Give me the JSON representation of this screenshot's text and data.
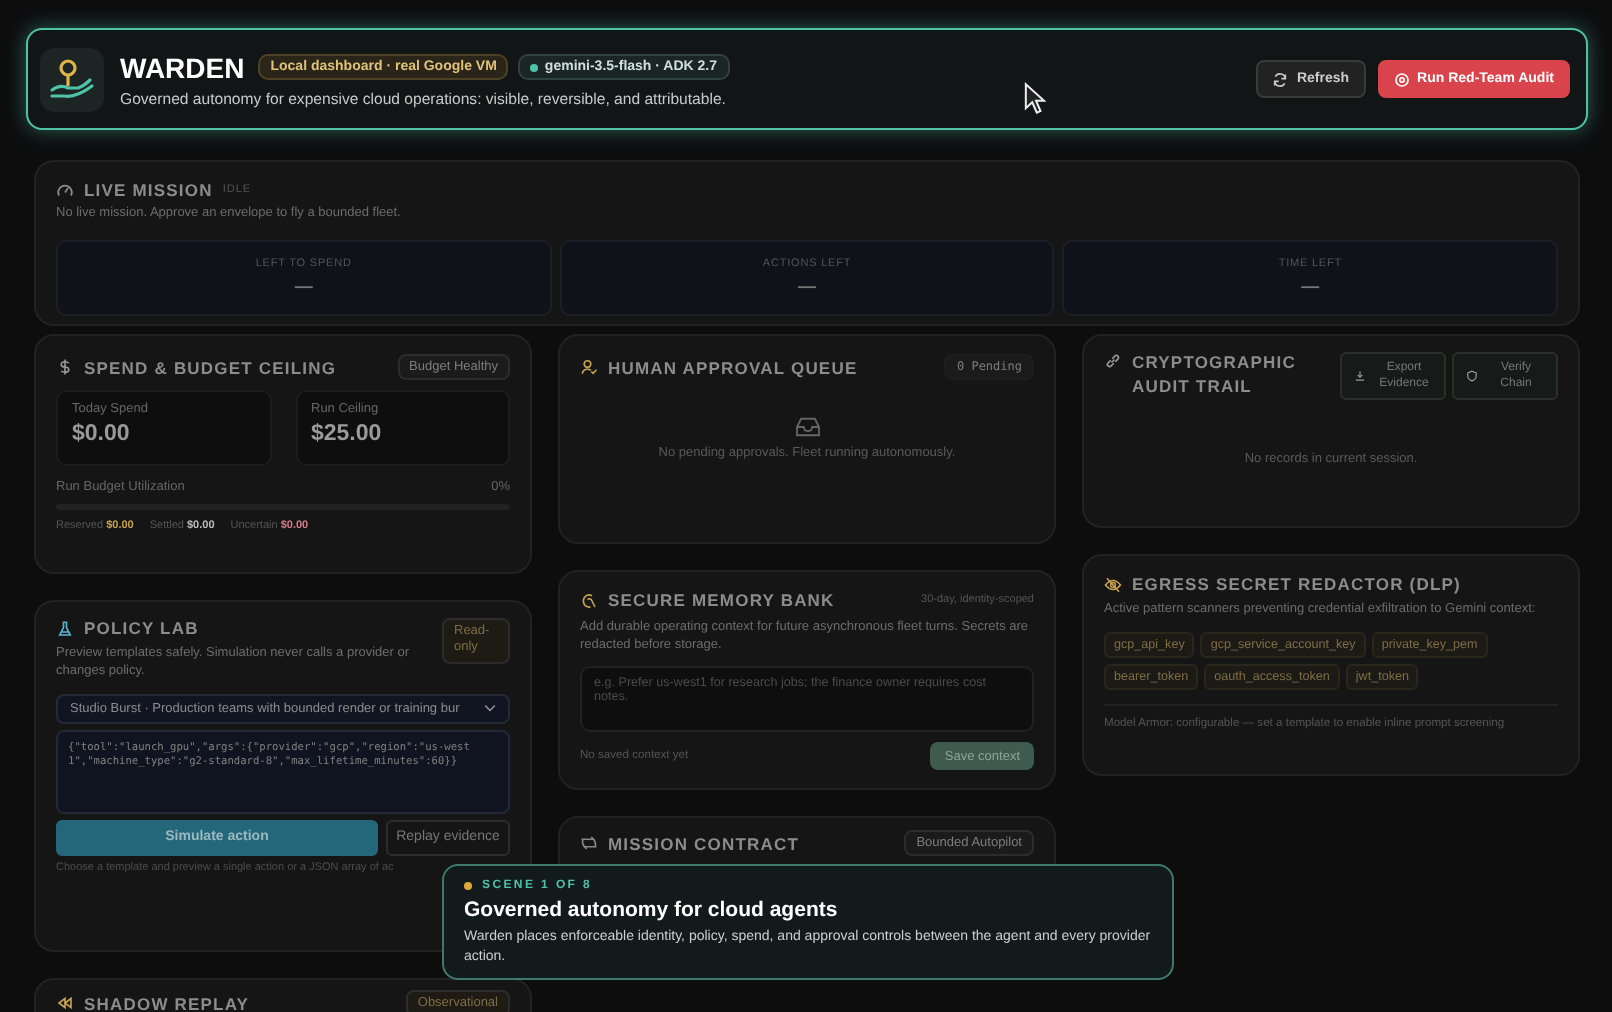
{
  "header": {
    "title": "WARDEN",
    "badges": [
      {
        "label": "Local dashboard · real Google VM",
        "kind": "env"
      },
      {
        "label": "gemini-3.5-flash · ADK 2.7",
        "kind": "model"
      }
    ],
    "subtitle": "Governed autonomy for expensive cloud operations: visible, reversible, and attributable.",
    "buttons": [
      {
        "label": "Refresh",
        "kind": "secondary"
      },
      {
        "label": "Run Red-Team Audit",
        "kind": "danger"
      }
    ]
  },
  "live_mission": {
    "title": "LIVE MISSION",
    "status": "IDLE",
    "message": "No live mission. Approve an envelope to fly a bounded fleet.",
    "stats": [
      {
        "label": "LEFT TO SPEND",
        "value": "—"
      },
      {
        "label": "ACTIONS LEFT",
        "value": "—"
      },
      {
        "label": "TIME LEFT",
        "value": "—"
      }
    ]
  },
  "spend": {
    "title": "SPEND & BUDGET CEILING",
    "badge": "Budget Healthy",
    "metrics": [
      {
        "label": "Today Spend",
        "value": "$0.00"
      },
      {
        "label": "Run Ceiling",
        "value": "$25.00"
      }
    ],
    "utilization": {
      "label": "Run Budget Utilization",
      "reading": "0%",
      "level": 0
    },
    "breakdown": [
      {
        "label": "Reserved",
        "value": "$0.00",
        "color": "#c9a24e"
      },
      {
        "label": "Settled",
        "value": "$0.00",
        "color": "#bdbdbd"
      },
      {
        "label": "Uncertain",
        "value": "$0.00",
        "color": "#d27a86"
      }
    ]
  },
  "policy_lab": {
    "title": "POLICY LAB",
    "badge": "Read-only",
    "description": "Preview templates safely. Simulation never calls a provider or changes policy.",
    "template": "Studio Burst · Production teams with bounded render or training bur",
    "action_json": "{\"tool\":\"launch_gpu\",\"args\":{\"provider\":\"gcp\",\"region\":\"us-west1\",\"machine_type\":\"g2-standard-8\",\"max_lifetime_minutes\":60}}",
    "buttons": [
      {
        "label": "Simulate action",
        "kind": "primary"
      },
      {
        "label": "Replay evidence",
        "kind": "secondary"
      }
    ],
    "hint": "Choose a template and preview a single action or a JSON array of ac"
  },
  "shadow_replay": {
    "title": "SHADOW REPLAY",
    "badge": "Observational"
  },
  "approval_queue": {
    "title": "HUMAN APPROVAL QUEUE",
    "badge": "0 Pending",
    "empty_message": "No pending approvals. Fleet running autonomously."
  },
  "memory_bank": {
    "title": "SECURE MEMORY BANK",
    "scope": "30-day, identity-scoped",
    "description": "Add durable operating context for future asynchronous fleet turns. Secrets are redacted before storage.",
    "input": {
      "placeholder": "e.g. Prefer us-west1 for research jobs; the finance owner requires cost notes."
    },
    "status": "No saved context yet",
    "button": "Save context"
  },
  "mission_contract": {
    "title": "MISSION CONTRACT",
    "badge": "Bounded Autopilot"
  },
  "audit_trail": {
    "title": "CRYPTOGRAPHIC AUDIT TRAIL",
    "buttons": [
      {
        "label": "Export Evidence",
        "kind": "export"
      },
      {
        "label": "Verify Chain",
        "kind": "verify"
      }
    ],
    "empty_message": "No records in current session."
  },
  "dlp": {
    "title": "EGRESS SECRET REDACTOR (DLP)",
    "description": "Active pattern scanners preventing credential exfiltration to Gemini context:",
    "patterns": [
      "gcp_api_key",
      "gcp_service_account_key",
      "private_key_pem",
      "bearer_token",
      "oauth_access_token",
      "jwt_token"
    ],
    "footer": "Model Armor: configurable — set a template to enable inline prompt screening"
  },
  "tour": {
    "step": "SCENE 1 OF 8",
    "title": "Governed autonomy for cloud agents",
    "body": "Warden places enforceable identity, policy, spend, and approval controls between the agent and every provider action."
  }
}
